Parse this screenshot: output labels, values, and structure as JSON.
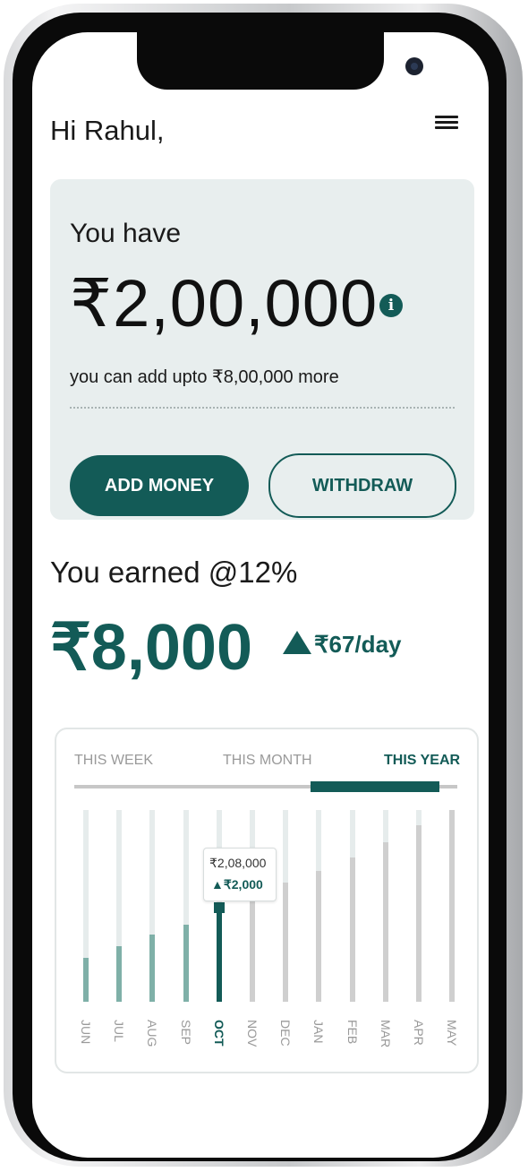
{
  "greeting": "Hi Rahul,",
  "wallet": {
    "label": "You have",
    "balance": "₹2,00,000",
    "info_glyph": "i",
    "limit_text": "you can add upto ₹8,00,000 more",
    "add_money_label": "ADD MONEY",
    "withdraw_label": "WITHDRAW"
  },
  "earnings": {
    "label": "You earned @12%",
    "amount": "₹8,000",
    "per_day": "₹67/day"
  },
  "tabs": [
    {
      "label": "THIS WEEK",
      "active": false
    },
    {
      "label": "THIS MONTH",
      "active": false
    },
    {
      "label": "THIS YEAR",
      "active": true
    }
  ],
  "tooltip": {
    "value": "₹2,08,000",
    "delta": "▲₹2,000"
  },
  "colors": {
    "primary": "#135b57",
    "card_bg": "#e8eeee",
    "past_bar": "#7fb0a8",
    "future_bar": "#cfcfcf"
  },
  "chart_data": {
    "type": "bar",
    "categories": [
      "JUN",
      "JUL",
      "AUG",
      "SEP",
      "OCT",
      "NOV",
      "DEC",
      "JAN",
      "FEB",
      "MAR",
      "APR",
      "MAY"
    ],
    "values": [
      0.23,
      0.29,
      0.35,
      0.4,
      0.5,
      0.56,
      0.62,
      0.68,
      0.75,
      0.83,
      0.92,
      1.0
    ],
    "selected": "OCT",
    "ylim": [
      0,
      1
    ]
  }
}
